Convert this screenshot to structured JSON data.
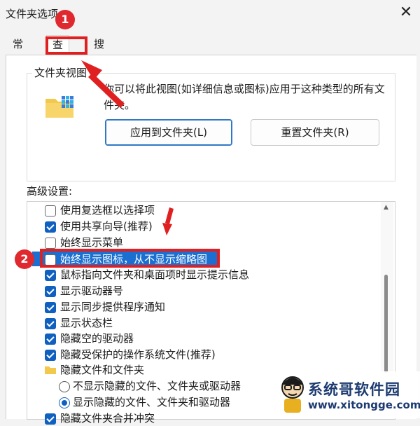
{
  "window": {
    "title": "文件夹选项",
    "close_glyph": "✕"
  },
  "tabs": [
    {
      "label": "常规",
      "selected": false
    },
    {
      "label": "查看",
      "selected": true
    },
    {
      "label": "搜索",
      "selected": false
    }
  ],
  "folder_views": {
    "group_title": "文件夹视图",
    "description": "你可以将此视图(如详细信息或图标)应用于这种类型的所有文件夹。",
    "apply_button": "应用到文件夹(L)",
    "reset_button": "重置文件夹(R)"
  },
  "advanced": {
    "label": "高级设置:",
    "items": [
      {
        "type": "checkbox",
        "label": "使用复选框以选择项",
        "checked": false
      },
      {
        "type": "checkbox",
        "label": "使用共享向导(推荐)",
        "checked": true
      },
      {
        "type": "checkbox",
        "label": "始终显示菜单",
        "checked": false
      },
      {
        "type": "checkbox",
        "label": "始终显示图标，从不显示缩略图",
        "checked": false,
        "selected": true
      },
      {
        "type": "checkbox",
        "label": "鼠标指向文件夹和桌面项时显示提示信息",
        "checked": true
      },
      {
        "type": "checkbox",
        "label": "显示驱动器号",
        "checked": true
      },
      {
        "type": "checkbox",
        "label": "显示同步提供程序通知",
        "checked": true
      },
      {
        "type": "checkbox",
        "label": "显示状态栏",
        "checked": true
      },
      {
        "type": "checkbox",
        "label": "隐藏空的驱动器",
        "checked": true
      },
      {
        "type": "checkbox",
        "label": "隐藏受保护的操作系统文件(推荐)",
        "checked": true
      },
      {
        "type": "folder",
        "label": "隐藏文件和文件夹"
      },
      {
        "type": "radio",
        "label": "不显示隐藏的文件、文件夹或驱动器",
        "checked": false
      },
      {
        "type": "radio",
        "label": "显示隐藏的文件、文件夹和驱动器",
        "checked": true
      },
      {
        "type": "checkbox",
        "label": "隐藏文件夹合并冲突",
        "checked": true
      }
    ]
  },
  "annotations": {
    "badge_1": "1",
    "badge_2": "2",
    "color": "#e02020"
  },
  "watermark": {
    "name": "系统哥软件园",
    "url": "www.xitongge.com"
  }
}
